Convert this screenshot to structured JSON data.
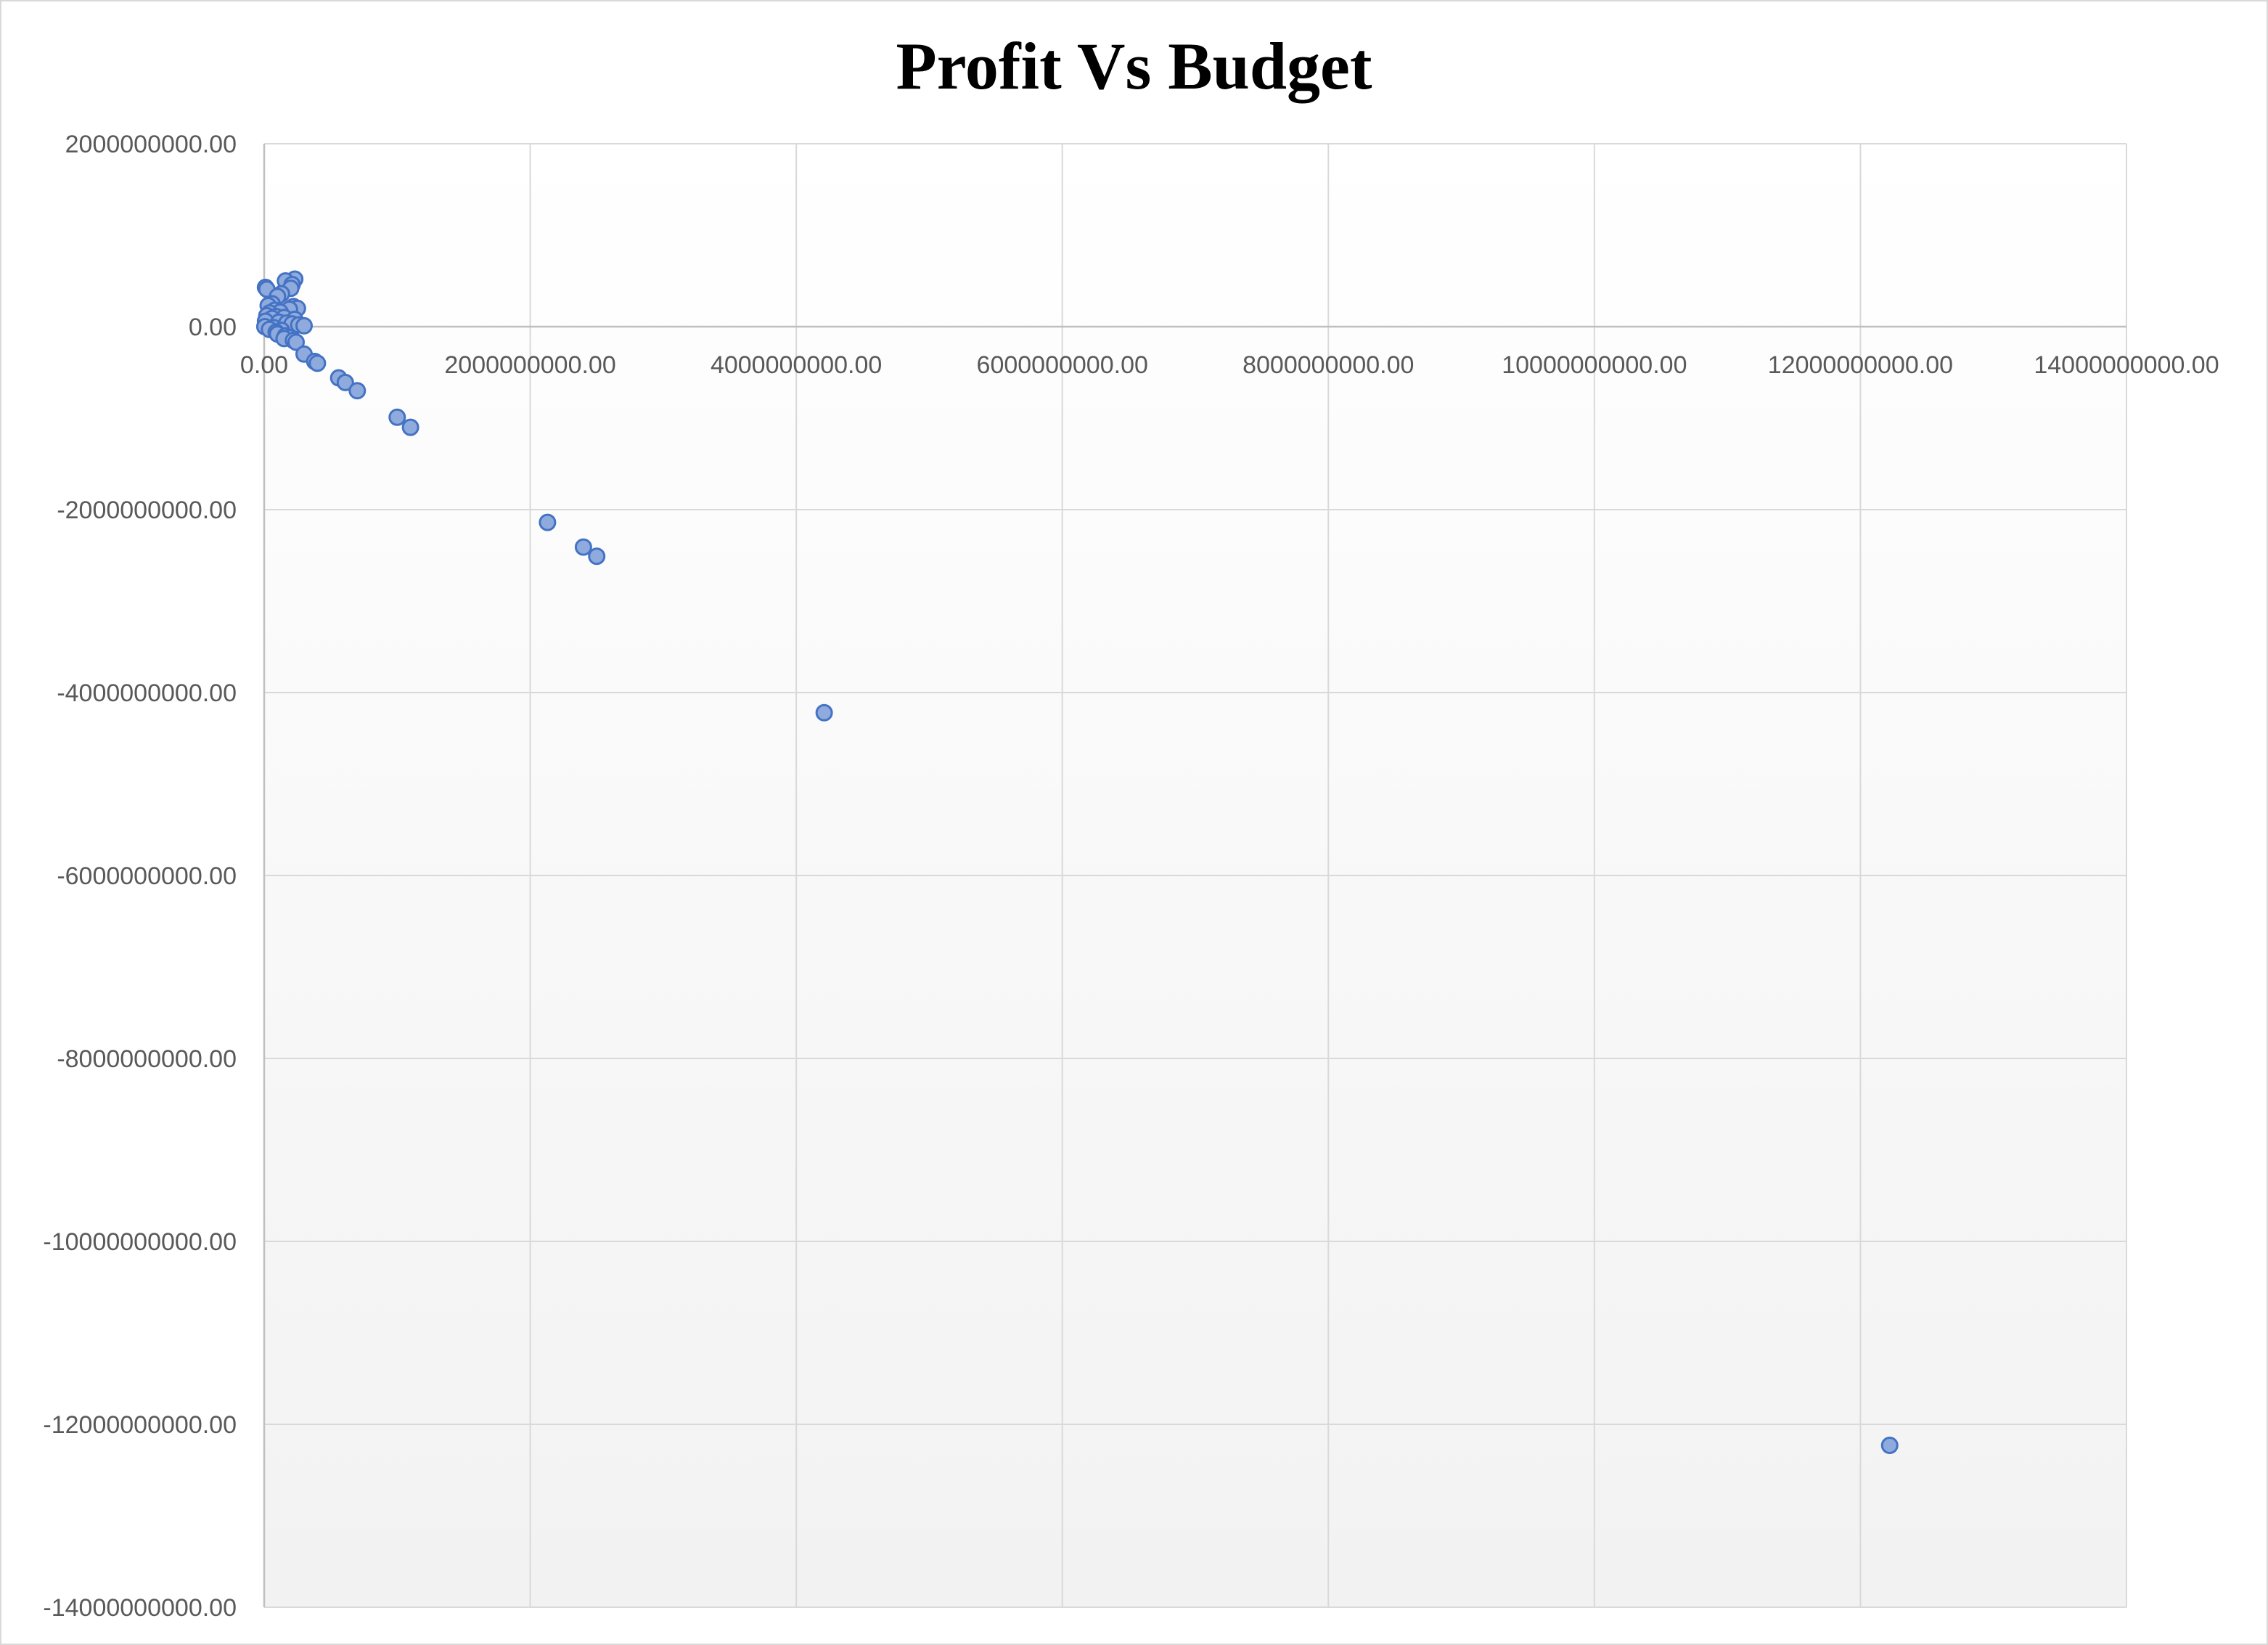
{
  "chart_data": {
    "type": "scatter",
    "title": "Profit Vs Budget",
    "xlabel": "",
    "ylabel": "",
    "xlim": [
      0,
      14000000000
    ],
    "ylim": [
      -14000000000,
      2000000000
    ],
    "grid": true,
    "legend": "none",
    "x_ticks": [
      {
        "value": 0,
        "label": "0.00"
      },
      {
        "value": 2000000000,
        "label": "2000000000.00"
      },
      {
        "value": 4000000000,
        "label": "4000000000.00"
      },
      {
        "value": 6000000000,
        "label": "6000000000.00"
      },
      {
        "value": 8000000000,
        "label": "8000000000.00"
      },
      {
        "value": 10000000000,
        "label": "10000000000.00"
      },
      {
        "value": 12000000000,
        "label": "12000000000.00"
      },
      {
        "value": 14000000000,
        "label": "14000000000.00"
      }
    ],
    "y_ticks": [
      {
        "value": 2000000000,
        "label": "2000000000.00"
      },
      {
        "value": 0,
        "label": "0.00"
      },
      {
        "value": -2000000000,
        "label": "-2000000000.00"
      },
      {
        "value": -4000000000,
        "label": "-4000000000.00"
      },
      {
        "value": -6000000000,
        "label": "-6000000000.00"
      },
      {
        "value": -8000000000,
        "label": "-8000000000.00"
      },
      {
        "value": -10000000000,
        "label": "-10000000000.00"
      },
      {
        "value": -12000000000,
        "label": "-12000000000.00"
      },
      {
        "value": -14000000000,
        "label": "-14000000000.00"
      }
    ],
    "marker_color": "#8faadc",
    "marker_edge_color": "#4472c4",
    "points": [
      {
        "x": 10000000,
        "y": 430000000
      },
      {
        "x": 20000000,
        "y": 410000000
      },
      {
        "x": 230000000,
        "y": 520000000
      },
      {
        "x": 160000000,
        "y": 500000000
      },
      {
        "x": 210000000,
        "y": 460000000
      },
      {
        "x": 200000000,
        "y": 420000000
      },
      {
        "x": 130000000,
        "y": 360000000
      },
      {
        "x": 100000000,
        "y": 330000000
      },
      {
        "x": 60000000,
        "y": 250000000
      },
      {
        "x": 30000000,
        "y": 230000000
      },
      {
        "x": 220000000,
        "y": 220000000
      },
      {
        "x": 250000000,
        "y": 200000000
      },
      {
        "x": 190000000,
        "y": 190000000
      },
      {
        "x": 80000000,
        "y": 180000000
      },
      {
        "x": 120000000,
        "y": 160000000
      },
      {
        "x": 40000000,
        "y": 150000000
      },
      {
        "x": 20000000,
        "y": 120000000
      },
      {
        "x": 90000000,
        "y": 110000000
      },
      {
        "x": 150000000,
        "y": 100000000
      },
      {
        "x": 60000000,
        "y": 90000000
      },
      {
        "x": 230000000,
        "y": 80000000
      },
      {
        "x": 10000000,
        "y": 60000000
      },
      {
        "x": 110000000,
        "y": 50000000
      },
      {
        "x": 170000000,
        "y": 40000000
      },
      {
        "x": 210000000,
        "y": 30000000
      },
      {
        "x": 260000000,
        "y": 20000000
      },
      {
        "x": 300000000,
        "y": 10000000
      },
      {
        "x": 5000000,
        "y": 0
      },
      {
        "x": 70000000,
        "y": -10000000
      },
      {
        "x": 40000000,
        "y": -30000000
      },
      {
        "x": 130000000,
        "y": -40000000
      },
      {
        "x": 90000000,
        "y": -60000000
      },
      {
        "x": 100000000,
        "y": -80000000
      },
      {
        "x": 160000000,
        "y": -100000000
      },
      {
        "x": 190000000,
        "y": -120000000
      },
      {
        "x": 150000000,
        "y": -130000000
      },
      {
        "x": 220000000,
        "y": -150000000
      },
      {
        "x": 240000000,
        "y": -170000000
      },
      {
        "x": 300000000,
        "y": -300000000
      },
      {
        "x": 380000000,
        "y": -380000000
      },
      {
        "x": 400000000,
        "y": -400000000
      },
      {
        "x": 560000000,
        "y": -560000000
      },
      {
        "x": 610000000,
        "y": -610000000
      },
      {
        "x": 700000000,
        "y": -700000000
      },
      {
        "x": 1000000000,
        "y": -990000000
      },
      {
        "x": 1100000000,
        "y": -1100000000
      },
      {
        "x": 2130000000,
        "y": -2140000000
      },
      {
        "x": 2400000000,
        "y": -2410000000
      },
      {
        "x": 2500000000,
        "y": -2510000000
      },
      {
        "x": 4210000000,
        "y": -4220000000
      },
      {
        "x": 12220000000,
        "y": -12230000000
      }
    ]
  }
}
